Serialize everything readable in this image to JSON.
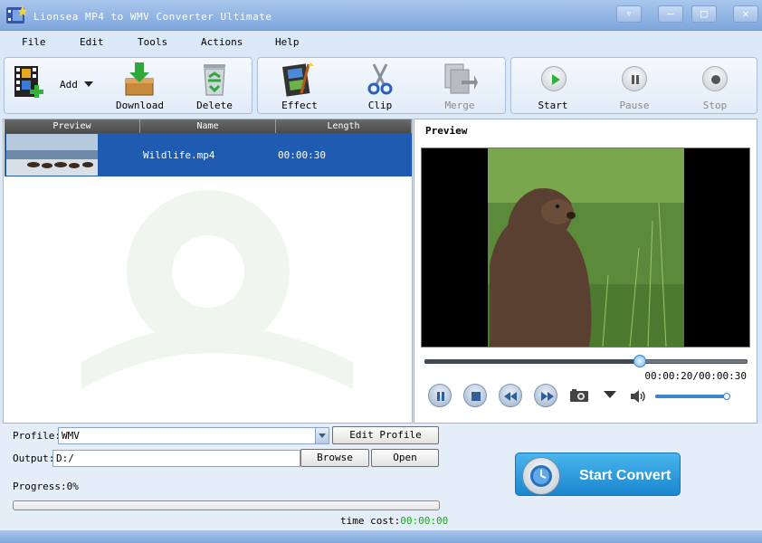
{
  "window": {
    "title": "Lionsea MP4 to WMV Converter Ultimate"
  },
  "menu": [
    "File",
    "Edit",
    "Tools",
    "Actions",
    "Help"
  ],
  "toolbar": {
    "add": "Add",
    "download": "Download",
    "delete": "Delete",
    "effect": "Effect",
    "clip": "Clip",
    "merge": "Merge",
    "start": "Start",
    "pause": "Pause",
    "stop": "Stop"
  },
  "list": {
    "columns": [
      "Preview",
      "Name",
      "Length"
    ],
    "rows": [
      {
        "name": "Wildlife.mp4",
        "length": "00:00:30"
      }
    ]
  },
  "preview": {
    "title": "Preview",
    "time": "00:00:20/00:00:30",
    "position": 0.667,
    "volume": 1.0
  },
  "output": {
    "profile_label": "Profile:",
    "profile_value": "WMV",
    "edit_profile": "Edit Profile",
    "output_label": "Output:",
    "output_value": "D:/",
    "browse": "Browse",
    "open": "Open",
    "progress_label": "Progress:",
    "progress_value": "0%",
    "progress": 0,
    "time_cost_label": "time cost:",
    "time_cost_value": "00:00:00",
    "start_convert": "Start Convert"
  },
  "colors": {
    "accent": "#1f5bb0",
    "timecost": "#11b011",
    "convert": "#2a99dd"
  }
}
